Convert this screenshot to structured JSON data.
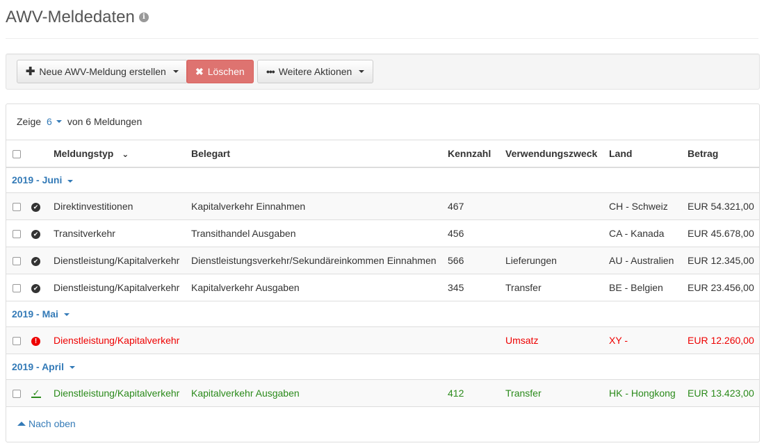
{
  "page": {
    "title": "AWV-Meldedaten"
  },
  "toolbar": {
    "new_label": "Neue AWV-Meldung erstellen",
    "delete_label": "Löschen",
    "more_label": "Weitere Aktionen"
  },
  "listing": {
    "show_prefix": "Zeige",
    "show_count": "6",
    "show_suffix": "von 6 Meldungen"
  },
  "columns": {
    "typ": "Meldungstyp",
    "beleg": "Belegart",
    "kennzahl": "Kennzahl",
    "zweck": "Verwendungszweck",
    "land": "Land",
    "betrag": "Betrag"
  },
  "groups": [
    {
      "label": "2019 - Juni",
      "rows": [
        {
          "status": "check-icon",
          "typ": "Direktinvestitionen",
          "beleg": "Kapitalverkehr Einnahmen",
          "kennzahl": "467",
          "zweck": "",
          "land": "CH - Schweiz",
          "betrag": "EUR 54.321,00"
        },
        {
          "status": "check-icon",
          "typ": "Transitverkehr",
          "beleg": "Transithandel Ausgaben",
          "kennzahl": "456",
          "zweck": "",
          "land": "CA - Kanada",
          "betrag": "EUR 45.678,00"
        },
        {
          "status": "check-icon",
          "typ": "Dienstleistung/Kapitalverkehr",
          "beleg": "Dienstleistungsverkehr/Sekundäreinkommen Einnahmen",
          "kennzahl": "566",
          "zweck": "Lieferungen",
          "land": "AU - Australien",
          "betrag": "EUR 12.345,00"
        },
        {
          "status": "check-icon",
          "typ": "Dienstleistung/Kapitalverkehr",
          "beleg": "Kapitalverkehr Ausgaben",
          "kennzahl": "345",
          "zweck": "Transfer",
          "land": "BE - Belgien",
          "betrag": "EUR 23.456,00"
        }
      ]
    },
    {
      "label": "2019 - Mai",
      "rows": [
        {
          "status": "error-icon",
          "typ": "Dienstleistung/Kapitalverkehr",
          "beleg": "",
          "kennzahl": "",
          "zweck": "Umsatz",
          "land": "XY -",
          "betrag": "EUR 12.260,00"
        }
      ]
    },
    {
      "label": "2019 - April",
      "rows": [
        {
          "status": "sent-icon",
          "typ": "Dienstleistung/Kapitalverkehr",
          "beleg": "Kapitalverkehr Ausgaben",
          "kennzahl": "412",
          "zweck": "Transfer",
          "land": "HK - Hongkong",
          "betrag": "EUR 13.423,00"
        }
      ]
    }
  ],
  "footer": {
    "back_to_top": "Nach oben"
  },
  "colors": {
    "link": "#337ab7",
    "error": "#e00000",
    "success": "#2a8a1a",
    "danger": "#d9534f"
  }
}
